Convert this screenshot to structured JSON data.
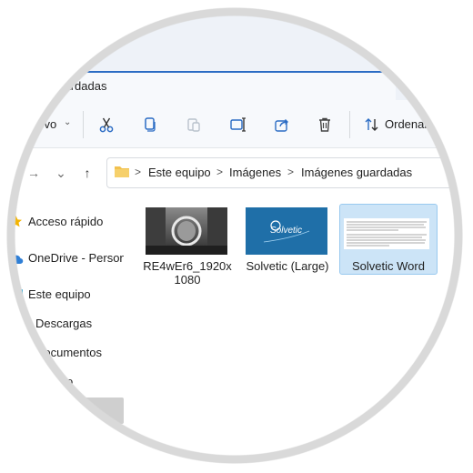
{
  "window": {
    "title": "guardadas"
  },
  "toolbar": {
    "new_label": "uevo",
    "chevron": "⌄",
    "icons": [
      "cut-icon",
      "copy-icon",
      "paste-icon",
      "rename-icon",
      "share-icon",
      "delete-icon",
      "sort-icon"
    ],
    "sort_label": "Ordenar"
  },
  "nav": {
    "forward": "→",
    "recent": "⌄",
    "up": "↑"
  },
  "breadcrumb": {
    "separator": ">",
    "items": [
      "Este equipo",
      "Imágenes",
      "Imágenes guardadas"
    ]
  },
  "sidebar": {
    "items": [
      {
        "label": "Acceso rápido",
        "icon": "star-icon"
      },
      {
        "label": "OneDrive - Persona",
        "icon": "cloud-icon"
      },
      {
        "label": "Este equipo",
        "icon": "monitor-icon"
      },
      {
        "label": "Descargas",
        "icon": "download-icon"
      },
      {
        "label": "Documentos",
        "icon": "document-icon"
      },
      {
        "label": "itorio",
        "icon": "desktop-icon"
      }
    ]
  },
  "files": [
    {
      "name_line1": "RE4wEr6_1920x",
      "name_line2": "1080",
      "type": "image-photo"
    },
    {
      "name_line1": "Solvetic (Large)",
      "name_line2": "",
      "type": "image-logo",
      "thumb_text": "Solvetic"
    },
    {
      "name_line1": "Solvetic Word",
      "name_line2": "",
      "type": "document",
      "selected": true
    }
  ],
  "colors": {
    "accent": "#2b6cc4",
    "selection": "#cce4f7",
    "folder": "#f2c14e",
    "star": "#f4b400",
    "onedrive": "#2f7fd6"
  }
}
